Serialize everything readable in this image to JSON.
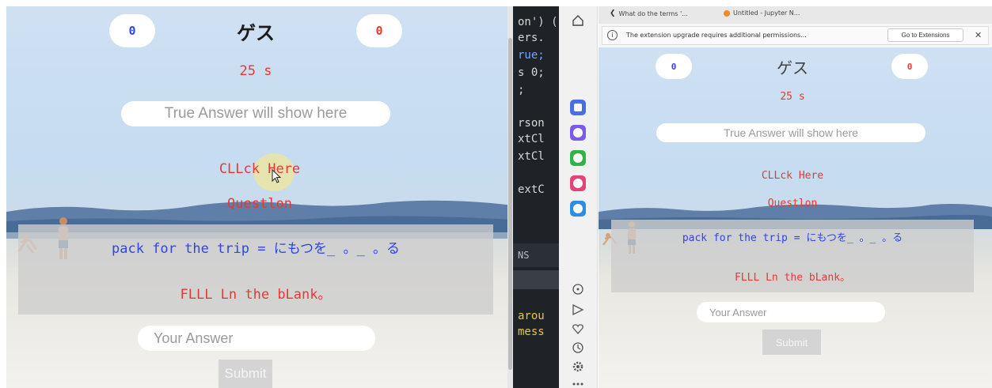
{
  "left_game": {
    "score_left": "0",
    "score_right": "0",
    "title": "ゲス",
    "timer": "25 s",
    "true_answer_placeholder": "True Answer will show here",
    "click_here": "CLLck Here",
    "question_label": "Questlon",
    "question_text": "pack for the trip = にもつを_ 。_ 。る",
    "hint": "FLLL Ln the bLank。",
    "answer_placeholder": "Your Answer",
    "submit_label": "Submit"
  },
  "editor": {
    "lines": [
      "on') (",
      "ers.",
      "rue;",
      "s 0;",
      ";",
      "rson",
      "xtCl",
      "xtCl",
      "extC",
      "NS",
      "arou",
      "mess"
    ]
  },
  "browser": {
    "tabs": [
      {
        "label": "What do the terms '...",
        "icon": "page-icon"
      },
      {
        "label": "Untitled - Jupyter N...",
        "icon": "jupyter-icon"
      }
    ],
    "infobar": {
      "message": "The extension upgrade requires additional permissions...",
      "button": "Go to Extensions"
    }
  },
  "right_game": {
    "score_left": "0",
    "score_right": "0",
    "title": "ゲス",
    "timer": "25 s",
    "true_answer_placeholder": "True Answer will show here",
    "click_here": "CLLck Here",
    "question_label": "Questlon",
    "question_text": "pack for the trip = にもつを_ 。_ 。る",
    "hint": "FLLL Ln the bLank。",
    "answer_placeholder": "Your Answer",
    "submit_label": "Submit"
  },
  "colors": {
    "score_left": "#2f44e6",
    "score_right": "#e53935",
    "red_text": "#e53935",
    "question_blue": "#2f44e6"
  }
}
